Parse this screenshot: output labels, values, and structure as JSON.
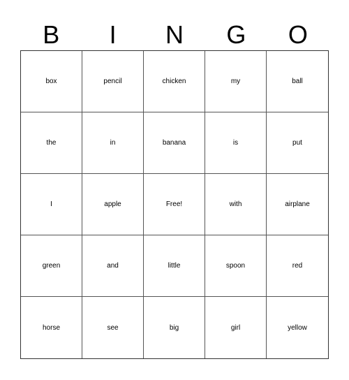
{
  "header": [
    "B",
    "I",
    "N",
    "G",
    "O"
  ],
  "cells": [
    [
      "box",
      "pencil",
      "chicken",
      "my",
      "ball"
    ],
    [
      "the",
      "in",
      "banana",
      "is",
      "put"
    ],
    [
      "I",
      "apple",
      "Free!",
      "with",
      "airplane"
    ],
    [
      "green",
      "and",
      "little",
      "spoon",
      "red"
    ],
    [
      "horse",
      "see",
      "big",
      "girl",
      "yellow"
    ]
  ]
}
